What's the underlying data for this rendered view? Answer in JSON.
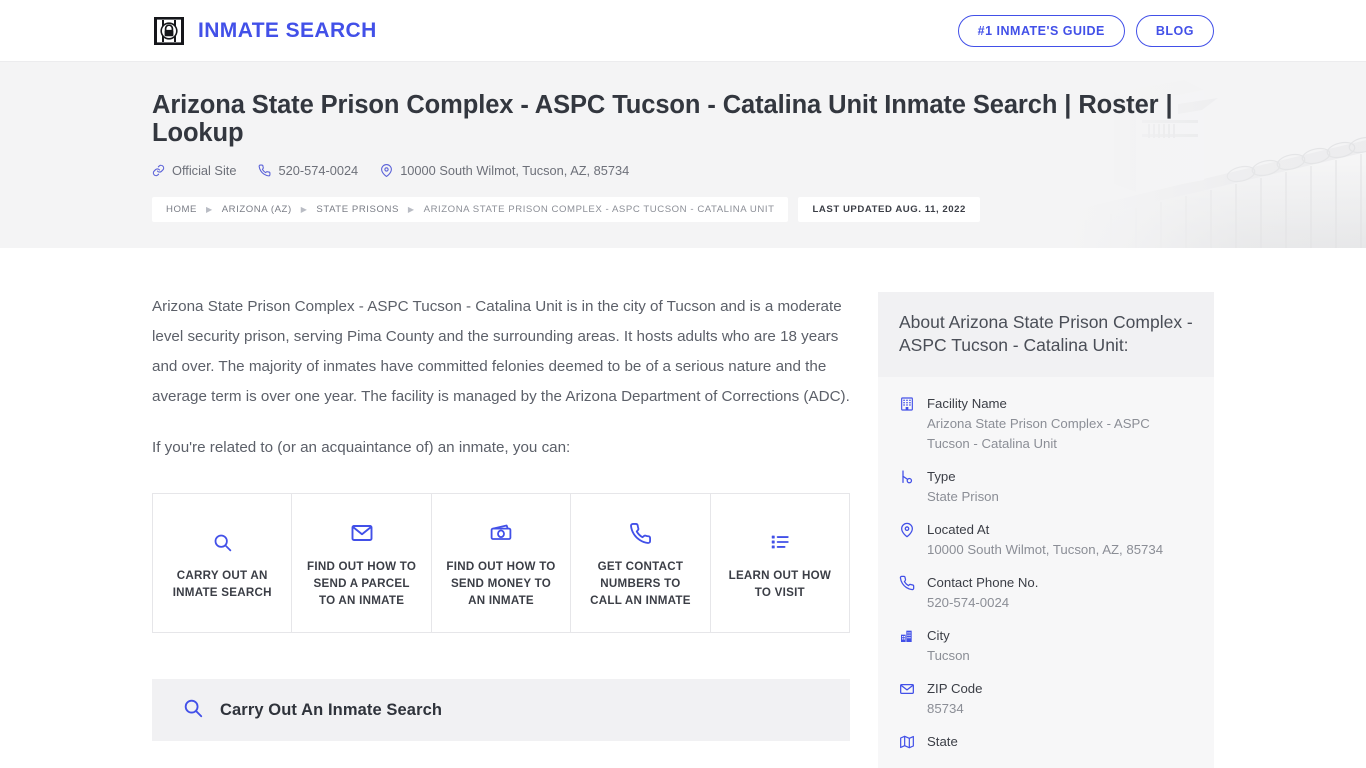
{
  "brand": {
    "name": "INMATE SEARCH",
    "logo_icon": "prison-bars-lock-icon",
    "accent": "#4250e8"
  },
  "nav": {
    "buttons": [
      {
        "label": "#1 INMATE'S GUIDE",
        "name": "inmates-guide-button"
      },
      {
        "label": "BLOG",
        "name": "blog-button"
      }
    ]
  },
  "hero": {
    "title": "Arizona State Prison Complex - ASPC Tucson - Catalina Unit Inmate Search | Roster | Lookup",
    "meta": [
      {
        "icon": "link-icon",
        "label": "Official Site"
      },
      {
        "icon": "phone-icon",
        "label": "520-574-0024"
      },
      {
        "icon": "map-pin-icon",
        "label": "10000 South Wilmot, Tucson, AZ, 85734"
      }
    ],
    "breadcrumbs": [
      "HOME",
      "ARIZONA (AZ)",
      "STATE PRISONS",
      "ARIZONA STATE PRISON COMPLEX - ASPC TUCSON - CATALINA UNIT"
    ],
    "breadcrumb_separator": "▶",
    "last_updated": "LAST UPDATED AUG. 11, 2022"
  },
  "main": {
    "paragraph_1": "Arizona State Prison Complex - ASPC Tucson - Catalina Unit is in the city of Tucson and is a moderate level security prison, serving Pima County and the surrounding areas. It hosts adults who are 18 years and over. The majority of inmates have committed felonies deemed to be of a serious nature and the average term is over one year. The facility is managed by the Arizona Department of Corrections (ADC).",
    "paragraph_2": "If you're related to (or an acquaintance of) an inmate, you can:",
    "actions": [
      {
        "label": "CARRY OUT AN INMATE SEARCH",
        "icon": "search-icon"
      },
      {
        "label": "FIND OUT HOW TO SEND A PARCEL TO AN INMATE",
        "icon": "envelope-icon"
      },
      {
        "label": "FIND OUT HOW TO SEND MONEY TO AN INMATE",
        "icon": "money-icon"
      },
      {
        "label": "GET CONTACT NUMBERS TO CALL AN INMATE",
        "icon": "phone-icon"
      },
      {
        "label": "LEARN OUT HOW TO VISIT",
        "icon": "list-icon"
      }
    ],
    "search_section": {
      "icon": "search-icon",
      "title": "Carry Out An Inmate Search"
    }
  },
  "sidebar": {
    "card_title": "About Arizona State Prison Complex - ASPC Tucson - Catalina Unit:",
    "facts": [
      {
        "icon": "building-icon",
        "key": "Facility Name",
        "value": "Arizona State Prison Complex - ASPC Tucson - Catalina Unit"
      },
      {
        "icon": "type-key-icon",
        "key": "Type",
        "value": "State Prison"
      },
      {
        "icon": "map-pin-icon",
        "key": "Located At",
        "value": "10000 South Wilmot, Tucson, AZ, 85734"
      },
      {
        "icon": "phone-icon",
        "key": "Contact Phone No.",
        "value": "520-574-0024"
      },
      {
        "icon": "city-icon",
        "key": "City",
        "value": "Tucson"
      },
      {
        "icon": "envelope-icon",
        "key": "ZIP Code",
        "value": "85734"
      },
      {
        "icon": "map-icon",
        "key": "State",
        "value": ""
      }
    ]
  }
}
